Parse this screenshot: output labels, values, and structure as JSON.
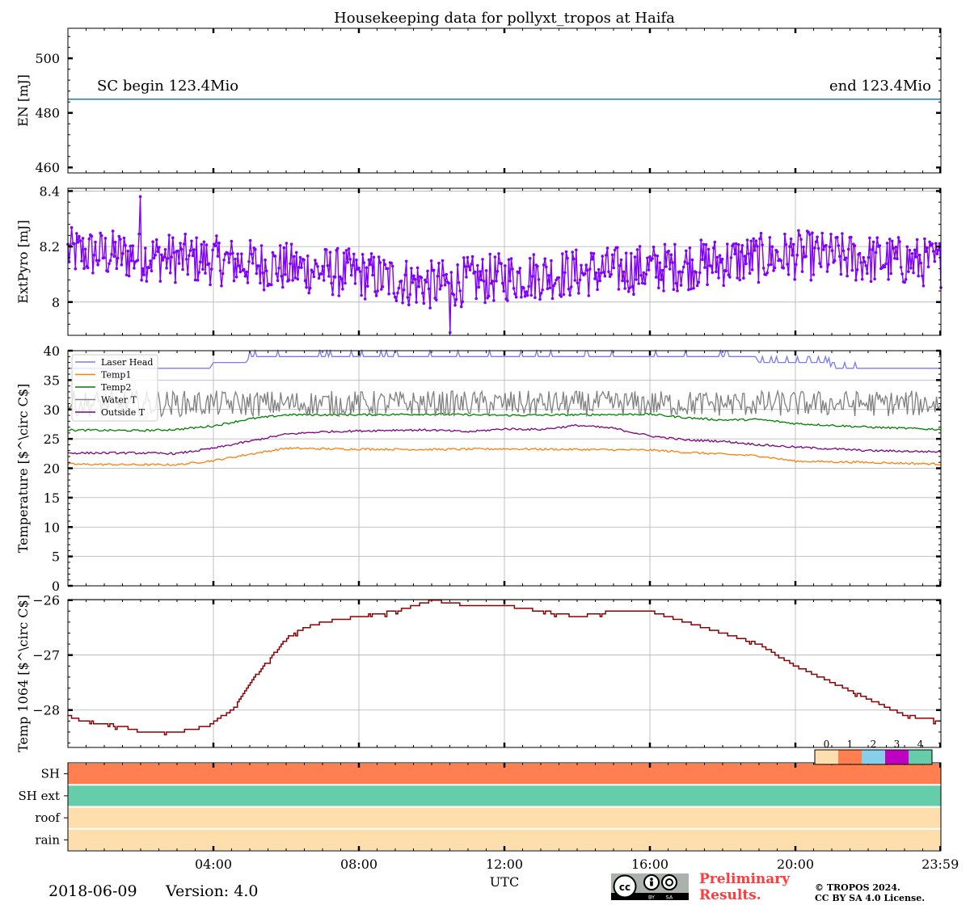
{
  "title": "Housekeeping data for pollyxt_tropos at Haifa",
  "x_axis": {
    "label": "UTC",
    "tick_labels": [
      "04:00",
      "08:00",
      "12:00",
      "16:00",
      "20:00",
      "23:59"
    ],
    "tick_hours": [
      4,
      8,
      12,
      16,
      20,
      23.983
    ],
    "range_hours": [
      0,
      24
    ]
  },
  "footer": {
    "date": "2018-06-09",
    "version": "Version: 4.0",
    "preliminary_line1": "Preliminary",
    "preliminary_line2": "Results.",
    "copyright": "© TROPOS 2024.",
    "license": "CC BY SA 4.0 License.",
    "cc_by": "BY",
    "cc_sa": "SA"
  },
  "chart_data": [
    {
      "type": "line",
      "ylabel": "EN [mJ]",
      "ylim": [
        458,
        511
      ],
      "yticks": [
        460,
        480,
        500
      ],
      "grid": false,
      "annotations": [
        "SC begin 123.4Mio",
        "end 123.4Mio"
      ],
      "series": [
        {
          "color": "#1f77b4",
          "x": [
            0,
            24
          ],
          "y": [
            485,
            485
          ]
        }
      ]
    },
    {
      "type": "line",
      "ylabel": "ExtPyro [mJ]",
      "ylim": [
        7.88,
        8.41
      ],
      "yticks": [
        8.0,
        8.2,
        8.4
      ],
      "grid": true,
      "markers": true,
      "series": [
        {
          "color": "#8000ff",
          "mean_profile": {
            "x": [
              0,
              4,
              8,
              10,
              12,
              16,
              20,
              24
            ],
            "y": [
              8.18,
              8.15,
              8.1,
              8.06,
              8.09,
              8.12,
              8.17,
              8.14
            ]
          },
          "spread": 0.09,
          "n_points": 700,
          "peak": {
            "x": 2.0,
            "y": 8.38
          },
          "min": {
            "x": 10.5,
            "y": 7.89
          }
        }
      ]
    },
    {
      "type": "line",
      "ylabel": "Temperature [$^\\circ C$]",
      "ylim": [
        0,
        40
      ],
      "yticks": [
        0,
        5,
        10,
        15,
        20,
        25,
        30,
        35,
        40
      ],
      "grid": true,
      "legend": "upper-left",
      "series": [
        {
          "name": "Laser Head",
          "color": "#7b7bf0",
          "x": [
            0,
            3.9,
            4.0,
            4.9,
            5.0,
            18.9,
            19.0,
            20.9,
            21.0,
            24
          ],
          "y": [
            37,
            37,
            38,
            38,
            39,
            39,
            38,
            38,
            37,
            37
          ]
        },
        {
          "name": "Temp1",
          "color": "#ff7f0e",
          "x": [
            0,
            2,
            3,
            4,
            5,
            6,
            7,
            10,
            12,
            14,
            16,
            17,
            18,
            19,
            20,
            22,
            24
          ],
          "y": [
            20.7,
            20.6,
            20.6,
            21.3,
            22.4,
            23.4,
            23.3,
            23.2,
            23.3,
            23.2,
            23.1,
            22.7,
            22.4,
            22.1,
            21.2,
            21.0,
            20.7
          ]
        },
        {
          "name": "Temp2",
          "color": "#008000",
          "x": [
            0,
            2,
            3,
            4,
            5,
            6,
            8,
            10,
            12,
            14,
            16,
            17,
            18,
            19,
            20,
            22,
            24
          ],
          "y": [
            26.5,
            26.4,
            26.6,
            27.2,
            28.4,
            29.1,
            29.1,
            29.2,
            29.0,
            29.1,
            29.2,
            28.6,
            28.2,
            28.3,
            27.6,
            27.0,
            26.6
          ]
        },
        {
          "name": "Water T",
          "color": "#808080",
          "mean_profile": {
            "x": [
              0,
              24
            ],
            "y": [
              31,
              31
            ]
          },
          "spread": 2.2
        },
        {
          "name": "Outside T",
          "color": "#800080",
          "x": [
            0,
            2,
            3,
            4,
            5,
            6,
            7,
            9,
            10,
            11,
            12,
            13,
            14,
            15,
            16,
            17,
            18,
            19,
            20,
            22,
            24
          ],
          "y": [
            22.6,
            22.6,
            22.5,
            23.4,
            24.6,
            25.8,
            26.2,
            26.5,
            26.5,
            26.2,
            26.7,
            26.6,
            27.3,
            26.8,
            25.5,
            24.8,
            24.6,
            24.0,
            23.6,
            23.0,
            22.8
          ]
        }
      ]
    },
    {
      "type": "line",
      "ylabel": "Temp 1064 [$^\\circ C$]",
      "ylim": [
        -28.68,
        -25.99
      ],
      "yticks": [
        -28,
        -27,
        -26
      ],
      "grid": true,
      "series": [
        {
          "color": "#8b0000",
          "x": [
            0,
            0.4,
            1.5,
            2.0,
            3.0,
            3.8,
            4.5,
            5.0,
            5.5,
            6.0,
            6.5,
            7.0,
            8.0,
            9.0,
            10.0,
            11.0,
            12.0,
            13.0,
            14.0,
            15.0,
            16.0,
            17.0,
            18.0,
            19.0,
            20.0,
            21.0,
            22.0,
            23.0,
            24.0
          ],
          "y": [
            -28.1,
            -28.2,
            -28.3,
            -28.4,
            -28.4,
            -28.3,
            -28.0,
            -27.5,
            -27.1,
            -26.7,
            -26.5,
            -26.4,
            -26.3,
            -26.2,
            -26.0,
            -26.1,
            -26.1,
            -26.2,
            -26.3,
            -26.2,
            -26.2,
            -26.4,
            -26.6,
            -26.8,
            -27.2,
            -27.5,
            -27.8,
            -28.1,
            -28.2
          ]
        }
      ]
    },
    {
      "type": "heatmap",
      "rows": [
        "SH",
        "SH ext",
        "roof",
        "rain"
      ],
      "values": [
        1,
        4,
        0,
        0
      ],
      "colorbar": {
        "labels": [
          "0",
          "1",
          "2",
          "3",
          "4"
        ],
        "colors": [
          "#ffdead",
          "#ff7f50",
          "#87ceeb",
          "#c000c0",
          "#66cdaa"
        ]
      }
    }
  ]
}
